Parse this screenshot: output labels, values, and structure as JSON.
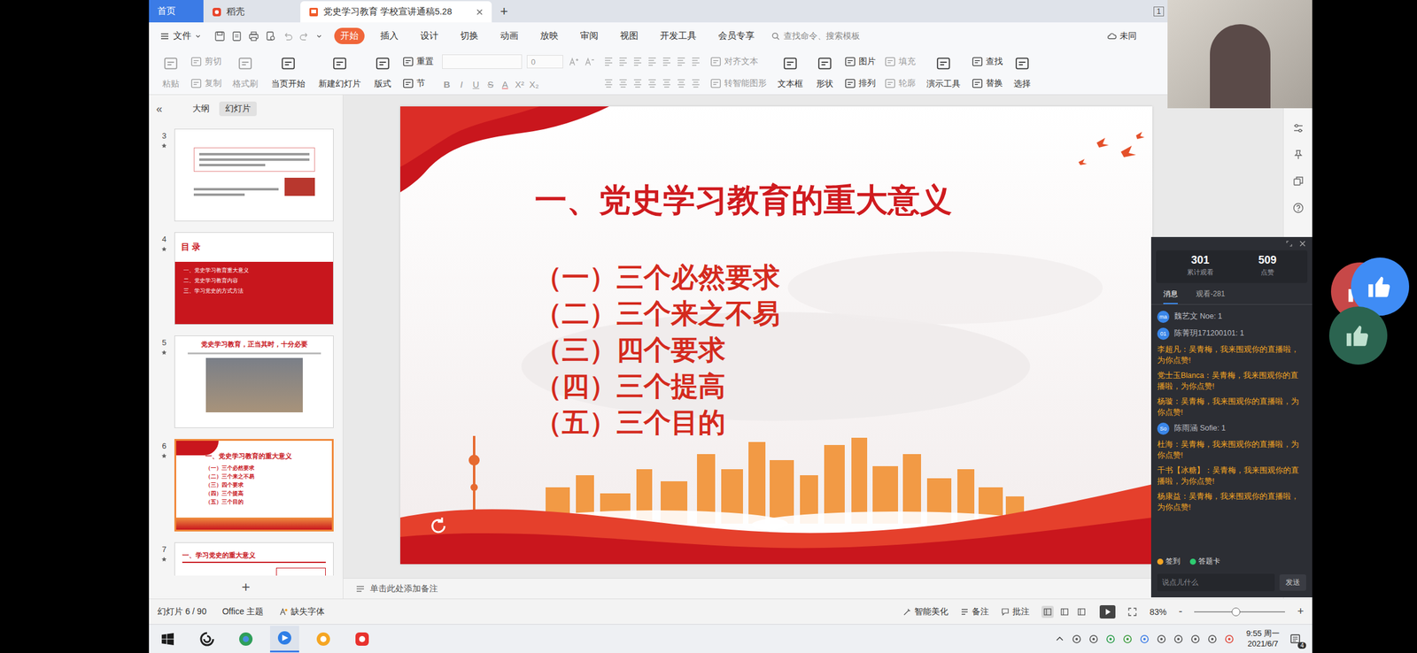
{
  "browser": {
    "tabs": [
      {
        "label": "首页",
        "kind": "home",
        "selected": false
      },
      {
        "label": "稻壳",
        "kind": "docer",
        "selected": false
      },
      {
        "label": "党史学习教育 学校宣讲通稿5.28",
        "kind": "doc",
        "selected": true
      }
    ],
    "new_tab": "+",
    "window_badge": "1"
  },
  "menu": {
    "file": "文件",
    "tabs": [
      {
        "label": "开始",
        "selected": true
      },
      {
        "label": "插入",
        "selected": false
      },
      {
        "label": "设计",
        "selected": false
      },
      {
        "label": "切换",
        "selected": false
      },
      {
        "label": "动画",
        "selected": false
      },
      {
        "label": "放映",
        "selected": false
      },
      {
        "label": "审阅",
        "selected": false
      },
      {
        "label": "视图",
        "selected": false
      },
      {
        "label": "开发工具",
        "selected": false
      },
      {
        "label": "会员专享",
        "selected": false
      }
    ],
    "search": "查找命令、搜索模板",
    "sync": "未同"
  },
  "ribbon": [
    {
      "kind": "large",
      "label": "粘贴",
      "disabled": true
    },
    {
      "kind": "stack",
      "items": [
        {
          "label": "剪切",
          "disabled": true
        },
        {
          "label": "复制",
          "disabled": true
        }
      ]
    },
    {
      "kind": "large",
      "label": "格式刷",
      "disabled": true
    },
    {
      "kind": "large",
      "label": "当页开始",
      "disabled": false
    },
    {
      "kind": "large",
      "label": "新建幻灯片",
      "disabled": false
    },
    {
      "kind": "large",
      "label": "版式",
      "disabled": false
    },
    {
      "kind": "stack",
      "items": [
        {
          "label": "重置",
          "disabled": false
        },
        {
          "label": "节",
          "disabled": false
        }
      ]
    },
    {
      "kind": "font",
      "size": "0",
      "disabled": true,
      "glyphs": [
        {
          "text": "B",
          "kind": "bold"
        },
        {
          "text": "I",
          "kind": "italic"
        },
        {
          "text": "U",
          "kind": "underline"
        },
        {
          "text": "S",
          "kind": "strike"
        },
        {
          "text": "A",
          "kind": "color"
        },
        {
          "text": "X²",
          "kind": "plain"
        },
        {
          "text": "X₂",
          "kind": "plain"
        }
      ]
    },
    {
      "kind": "para",
      "disabled": true
    },
    {
      "kind": "stack",
      "items": [
        {
          "label": "对齐文本",
          "disabled": true
        },
        {
          "label": "转智能图形",
          "disabled": true
        }
      ]
    },
    {
      "kind": "large",
      "label": "文本框",
      "disabled": false
    },
    {
      "kind": "large",
      "label": "形状",
      "disabled": false
    },
    {
      "kind": "stack",
      "items": [
        {
          "label": "图片",
          "disabled": false
        },
        {
          "label": "排列",
          "disabled": false
        }
      ]
    },
    {
      "kind": "stack",
      "items": [
        {
          "label": "填充",
          "disabled": true
        },
        {
          "label": "轮廓",
          "disabled": true
        }
      ]
    },
    {
      "kind": "large",
      "label": "演示工具",
      "disabled": false
    },
    {
      "kind": "stack",
      "items": [
        {
          "label": "查找",
          "disabled": false
        },
        {
          "label": "替换",
          "disabled": false
        }
      ]
    },
    {
      "kind": "large",
      "label": "选择",
      "disabled": false
    }
  ],
  "panel": {
    "collapse": "«",
    "tabs": [
      {
        "label": "大纲",
        "selected": false
      },
      {
        "label": "幻灯片",
        "selected": true
      }
    ],
    "add": "+",
    "thumbnails": [
      {
        "number": "3",
        "starred": true,
        "selected": false,
        "kind": "quote"
      },
      {
        "number": "4",
        "starred": true,
        "selected": false,
        "kind": "toc",
        "title": "目 录",
        "lines": [
          "一、党史学习教育重大意义",
          "二、党史学习教育内容",
          "三、学习党史的方式方法"
        ]
      },
      {
        "number": "5",
        "starred": true,
        "selected": false,
        "kind": "photo",
        "title": "党史学习教育，正当其时，十分必要"
      },
      {
        "number": "6",
        "starred": true,
        "selected": true,
        "kind": "list",
        "title": "一、党史学习教育的重大意义",
        "lines": [
          "（一）三个必然要求",
          "（二）三个来之不易",
          "（三）四个要求",
          "（四）三个提高",
          "（五）三个目的"
        ]
      },
      {
        "number": "7",
        "starred": true,
        "selected": false,
        "kind": "heading",
        "title": "一、学习党史的重大意义"
      }
    ]
  },
  "slide": {
    "title": "一、党史学习教育的重大意义",
    "items": [
      "（一）三个必然要求",
      "（二）三个来之不易",
      "（三）四个要求",
      "（四）三个提高",
      "（五）三个目的"
    ]
  },
  "notes": "单击此处添加备注",
  "status": {
    "slide_count": "幻灯片 6 / 90",
    "theme": "Office 主题",
    "missing_font": "缺失字体",
    "beautify": "智能美化",
    "notes": "备注",
    "comments": "批注",
    "views": [
      {
        "selected": true
      },
      {
        "selected": false
      },
      {
        "selected": false
      }
    ],
    "zoom": "83%",
    "zoom_minus": "-",
    "zoom_plus": "+",
    "zoom_level": 0.45
  },
  "live": {
    "stats": [
      {
        "value": "301",
        "label": "累计观看"
      },
      {
        "value": "509",
        "label": "点赞"
      }
    ],
    "tabs": [
      {
        "label": "消息",
        "selected": true
      },
      {
        "label": "观看-281",
        "selected": false
      }
    ],
    "messages": [
      {
        "kind": "system",
        "avatar": "ma",
        "text": "魏艺文 Noe: 1"
      },
      {
        "kind": "system",
        "avatar": "01",
        "text": "陈菁玥171200101: 1"
      },
      {
        "kind": "like",
        "text": "李超凡：吴青梅，我来围观你的直播啦，为你点赞!"
      },
      {
        "kind": "like",
        "text": "党士玉Blanca：吴青梅，我来围观你的直播啦，为你点赞!"
      },
      {
        "kind": "like",
        "text": "杨璇：吴青梅，我来围观你的直播啦，为你点赞!"
      },
      {
        "kind": "system",
        "avatar": "So",
        "text": "陈雨涵 Sofie: 1"
      },
      {
        "kind": "like",
        "text": "杜海：吴青梅，我来围观你的直播啦，为你点赞!"
      },
      {
        "kind": "like",
        "text": "千书【冰糖】：吴青梅，我来围观你的直播啦，为你点赞!"
      },
      {
        "kind": "like",
        "text": "杨康益：吴青梅，我来围观你的直播啦，为你点赞!"
      }
    ],
    "actions": [
      {
        "label": "签到",
        "color": "#f5a623"
      },
      {
        "label": "答题卡",
        "color": "#2ecc71"
      }
    ],
    "input_placeholder": "说点儿什么",
    "send": "发送"
  },
  "reactions": [
    {
      "color": "#c74848"
    },
    {
      "color": "#3f8cf5"
    },
    {
      "color": "#2b6450"
    }
  ],
  "taskbar": {
    "apps": [
      {
        "active": false
      },
      {
        "active": false
      },
      {
        "active": true
      },
      {
        "active": false
      },
      {
        "active": false
      }
    ],
    "time": "9:55 周一",
    "date": "2021/6/7",
    "notifications": "4"
  }
}
